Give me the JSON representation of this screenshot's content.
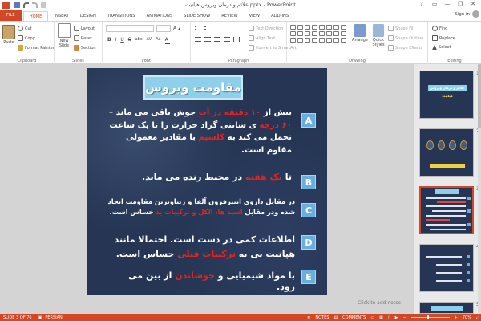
{
  "window": {
    "title": "علائم و درمان ویروس هپاتیت.pptx - PowerPoint",
    "sign_in": "Sign in",
    "min": "—",
    "restore": "❐",
    "close": "✕"
  },
  "tabs": [
    "FILE",
    "HOME",
    "INSERT",
    "DESIGN",
    "TRANSITIONS",
    "ANIMATIONS",
    "SLIDE SHOW",
    "REVIEW",
    "VIEW",
    "ADD-INS"
  ],
  "ribbon": {
    "clipboard": {
      "paste": "Paste",
      "cut": "Cut",
      "copy": "Copy",
      "format_painter": "Format Painter",
      "label": "Clipboard"
    },
    "slides": {
      "new_slide_1": "New",
      "new_slide_2": "Slide",
      "layout": "Layout",
      "reset": "Reset",
      "section": "Section",
      "label": "Slides"
    },
    "font": {
      "label": "Font",
      "bold": "B",
      "italic": "I",
      "underline": "U",
      "strike": "S",
      "shadow": "abc",
      "spacing": "AV",
      "case": "Aa"
    },
    "paragraph": {
      "text_direction": "Text Direction",
      "align_text": "Align Text",
      "convert_smartart": "Convert to SmartArt",
      "label": "Paragraph"
    },
    "drawing": {
      "arrange": "Arrange",
      "quick_styles_1": "Quick",
      "quick_styles_2": "Styles",
      "shape_fill": "Shape Fill",
      "shape_outline": "Shape Outline",
      "shape_effects": "Shape Effects",
      "label": "Drawing"
    },
    "editing": {
      "find": "Find",
      "replace": "Replace",
      "select": "Select",
      "label": "Editing"
    }
  },
  "slide": {
    "title": "مقاومت ویروس",
    "badges": [
      "A",
      "B",
      "C",
      "D",
      "E"
    ],
    "p1": [
      {
        "t": "بیش از ",
        "red": false
      },
      {
        "t": "۱۰ دقیقه در آب",
        "red": true
      },
      {
        "t": " جوش باقی می ماند – ",
        "red": false
      },
      {
        "t": "۶۰ درجه",
        "red": true
      },
      {
        "t": " ی سانتی گراد حرارت را تا یک ساعت تحمل می کند به ",
        "red": false
      },
      {
        "t": "کلسیم",
        "red": true
      },
      {
        "t": " با مقادیر معمولی مقاوم است.",
        "red": false
      }
    ],
    "p2": [
      {
        "t": "تا ",
        "red": false
      },
      {
        "t": "یک هفته",
        "red": true
      },
      {
        "t": " در محیط زنده می ماند.",
        "red": false
      }
    ],
    "p3": [
      {
        "t": "در مقابل داروی اینترفرون آلفا و ریباویرین مقاومت ایجاد شده ودر مقابل ",
        "red": false
      },
      {
        "t": "اسید ها، الکل و ترکیبات ید",
        "red": true
      },
      {
        "t": " حساس است.",
        "red": false
      }
    ],
    "p4": "اطلاعات کمی در دست است. احتمالا مانند هپاتیت بی به",
    "p4_red": " ترکیبات فنلی",
    "p4_end": " حساس است.",
    "p5": [
      {
        "t": "با مواد شیمیایی و ",
        "red": false
      },
      {
        "t": "جوشاندن",
        "red": true
      },
      {
        "t": " از بین می رود.",
        "red": false
      }
    ],
    "click_to_add_notes": "Click to add notes"
  },
  "thumbnails": {
    "numbers": [
      "1",
      "2",
      "3",
      "4",
      "5"
    ],
    "t1_title": "علائم و درمان ویروس",
    "t1_sub": "هپاتیت",
    "t2_label": "ویروس های هپاتیت"
  },
  "status": {
    "slide_of": "SLIDE 3 OF 76",
    "language": "PERSIAN",
    "notes": "NOTES",
    "comments": "COMMENTS",
    "zoom": "70%"
  },
  "colors": {
    "accent": "#d24726",
    "slide_bg": "#253553",
    "title_box": "#8ecfea",
    "highlight_red": "#e4231f"
  }
}
